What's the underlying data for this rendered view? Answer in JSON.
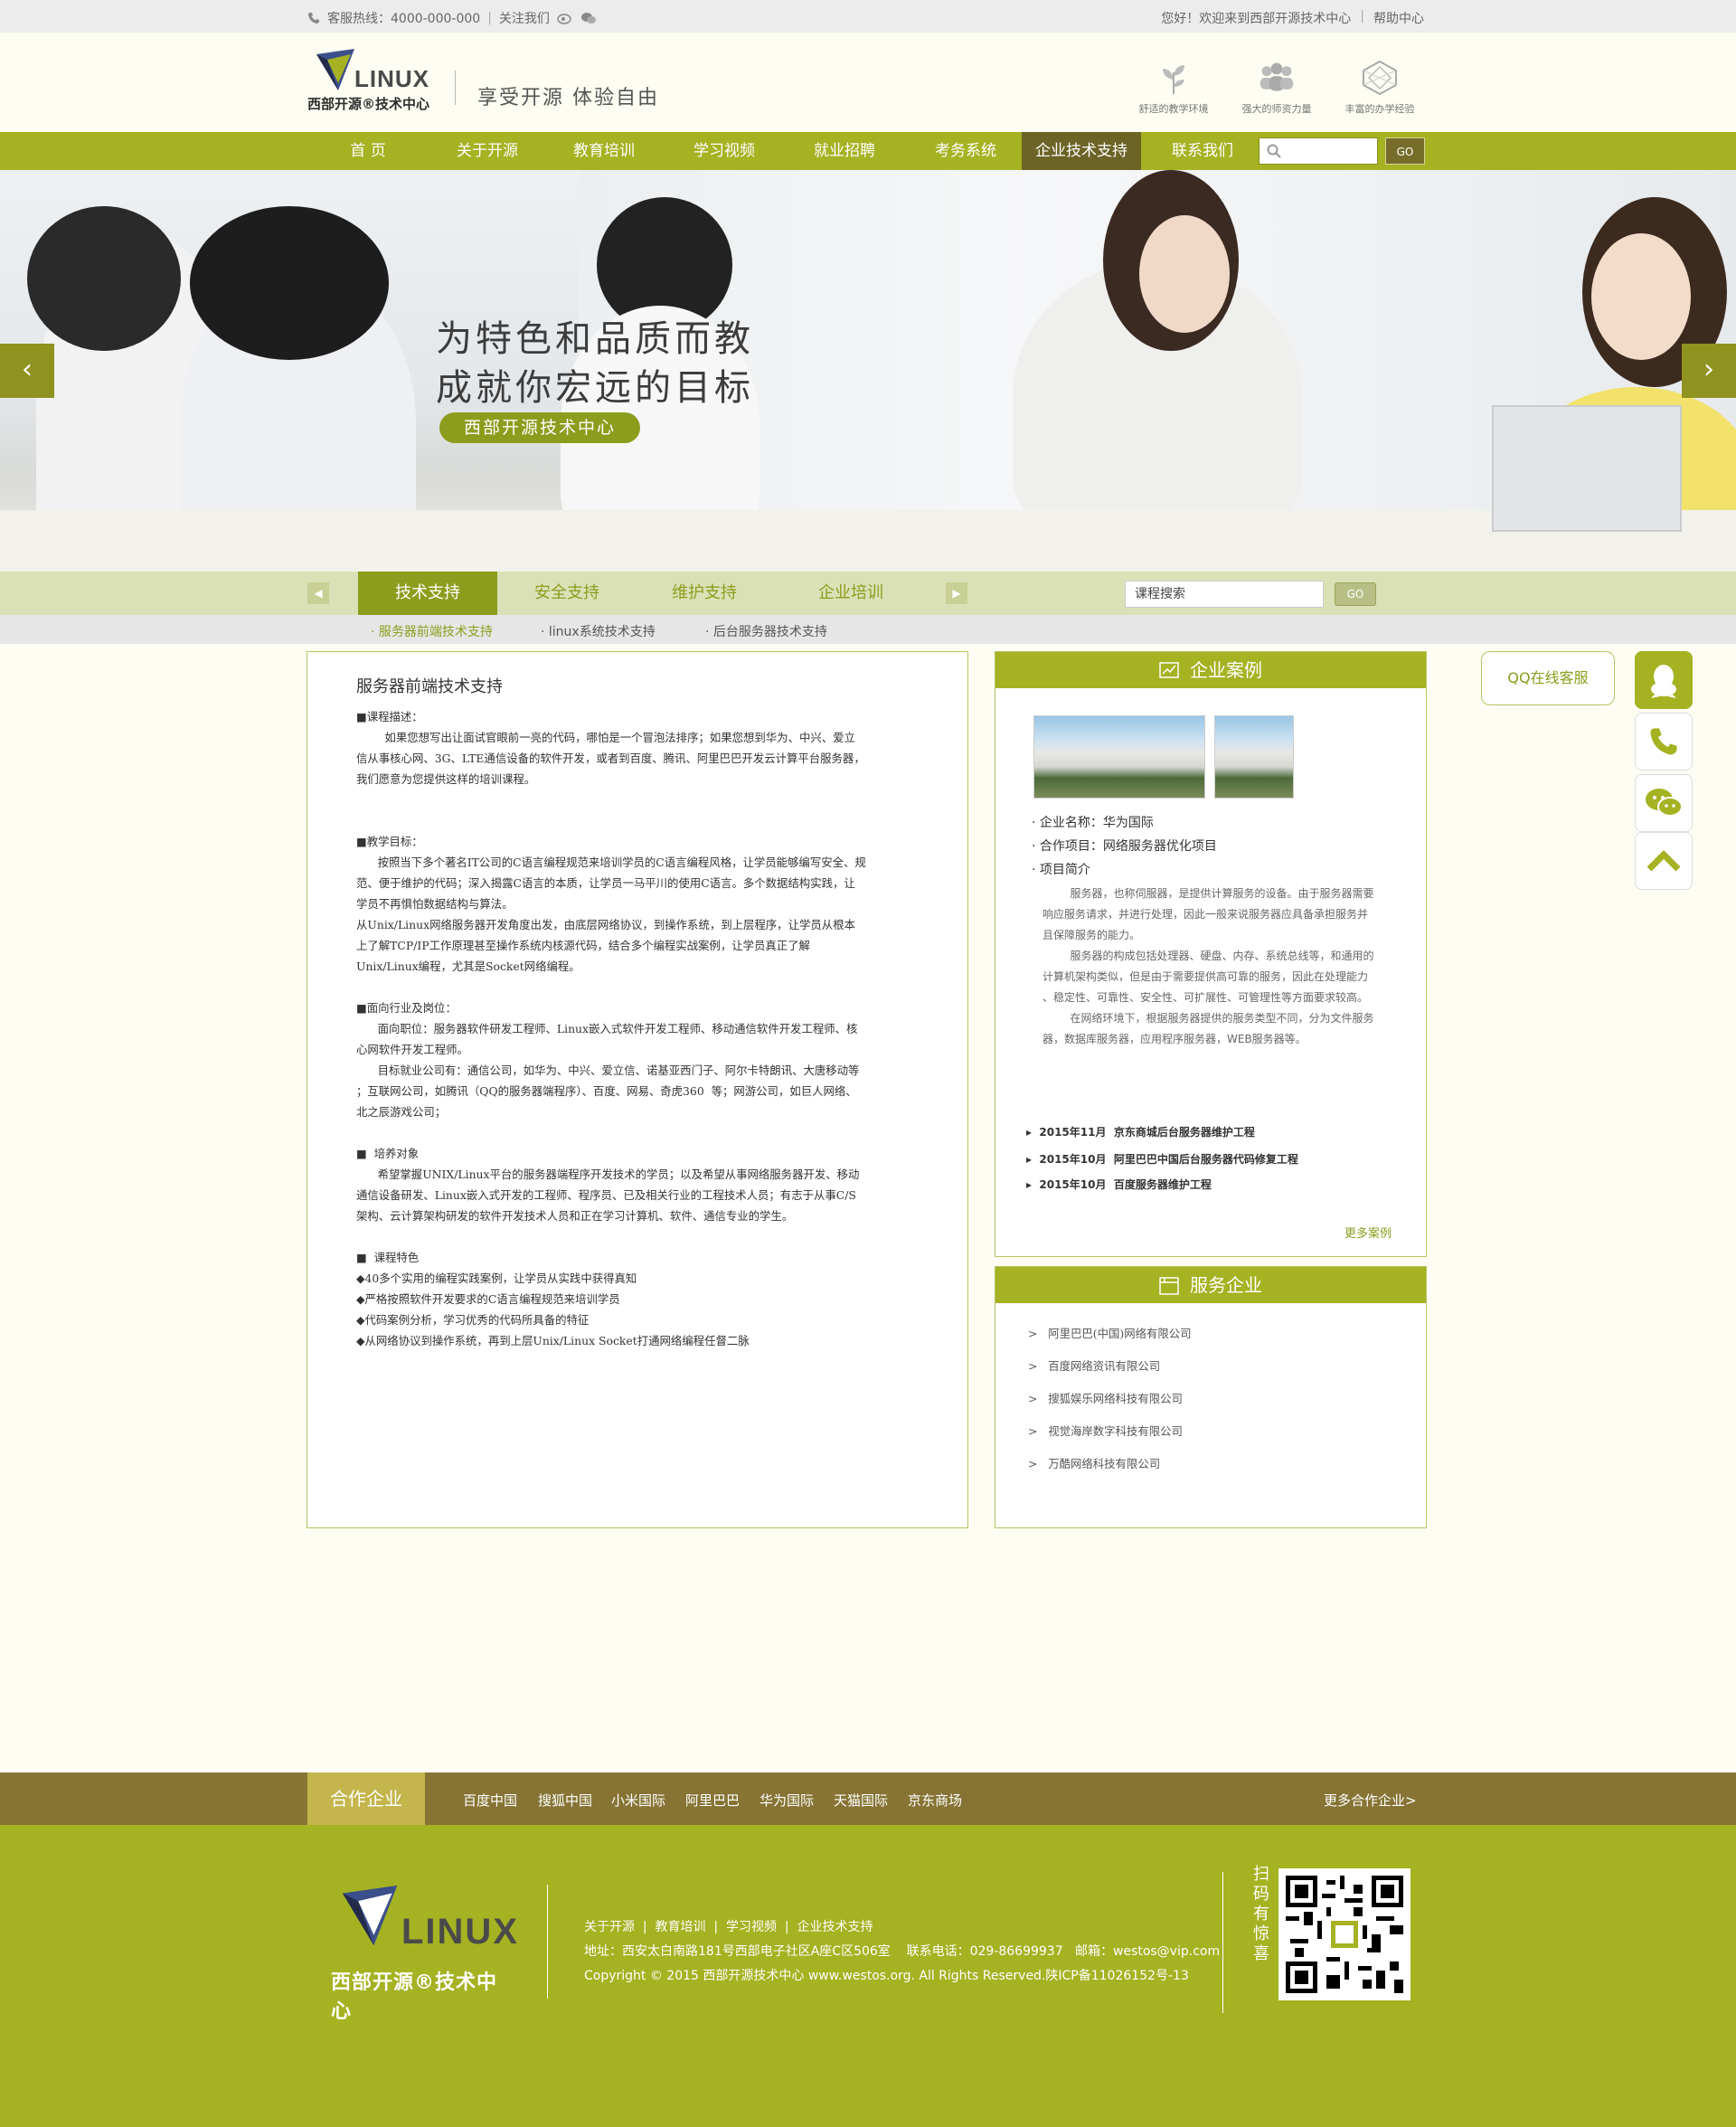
{
  "topbar": {
    "hotline": "客服热线：4000-000-000",
    "follow": "关注我们",
    "welcome": "您好！欢迎来到西部开源技术中心",
    "help": "帮助中心"
  },
  "header": {
    "logo_en": "LINUX",
    "logo_cn": "西部开源®技术中心",
    "slogan": "享受开源  体验自由",
    "features": [
      "舒适的教学环境",
      "强大的师资力量",
      "丰富的办学经验"
    ]
  },
  "nav": {
    "items": [
      "首  页",
      "关于开源",
      "教育培训",
      "学习视频",
      "就业招聘",
      "考务系统",
      "企业技术支持",
      "联系我们"
    ],
    "active": "企业技术支持",
    "search_go": "GO"
  },
  "banner": {
    "line1": "为特色和品质而教",
    "line2": "成就你宏远的目标",
    "tag": "西部开源技术中心",
    "prev": "‹",
    "next": "›"
  },
  "tabs": {
    "items": [
      "技术支持",
      "安全支持",
      "维护支持",
      "企业培训"
    ],
    "search_placeholder": "课程搜索",
    "go": "GO",
    "sub": [
      "· 服务器前端技术支持",
      "· linux系统技术支持",
      "· 后台服务器技术支持"
    ]
  },
  "main": {
    "title": "服务器前端技术支持",
    "paragraphs": [
      "■课程描述：",
      "        如果您想写出让面试官眼前一亮的代码，哪怕是一个冒泡法排序；如果您想到华为、中兴、爱立",
      "信从事核心网、3G、LTE通信设备的软件开发，或者到百度、腾讯、阿里巴巴开发云计算平台服务器，",
      "我们愿意为您提供这样的培训课程。",
      "",
      "",
      "■教学目标：",
      "      按照当下多个著名IT公司的C语言编程规范来培训学员的C语言编程风格，让学员能够编写安全、规",
      "范、便于维护的代码；深入揭露C语言的本质，让学员一马平川的使用C语言。多个数据结构实践，让",
      "学员不再惧怕数据结构与算法。",
      "从Unix/Linux网络服务器开发角度出发，由底层网络协议，到操作系统，到上层程序，让学员从根本",
      "上了解TCP/IP工作原理甚至操作系统内核源代码，结合多个编程实战案例，让学员真正了解",
      "Unix/Linux编程，尤其是Socket网络编程。",
      "",
      "■面向行业及岗位：",
      "      面向职位：服务器软件研发工程师、Linux嵌入式软件开发工程师、移动通信软件开发工程师、核",
      "心网软件开发工程师。",
      "      目标就业公司有：通信公司，如华为、中兴、爱立信、诺基亚西门子、阿尔卡特朗讯、大唐移动等",
      "；互联网公司，如腾讯（QQ的服务器端程序）、百度、网易、奇虎360  等；网游公司，如巨人网络、",
      "北之辰游戏公司；",
      "",
      "■  培养对象",
      "      希望掌握UNIX/Linux平台的服务器端程序开发技术的学员；以及希望从事网络服务器开发、移动",
      "通信设备研发、Linux嵌入式开发的工程师、程序员、已及相关行业的工程技术人员；有志于从事C/S",
      "架构、云计算架构研发的软件开发技术人员和正在学习计算机、软件、通信专业的学生。",
      "",
      "■  课程特色",
      "◆40多个实用的编程实践案例，让学员从实践中获得真知",
      "◆严格按照软件开发要求的C语言编程规范来培训学员",
      "◆代码案例分析，学习优秀的代码所具备的特征",
      "◆从网络协议到操作系统，再到上层Unix/Linux Socket打通网络编程任督二脉"
    ]
  },
  "cases": {
    "title": "企业案例",
    "company": "· 企业名称：华为国际",
    "project": "· 合作项目：网络服务器优化项目",
    "intro": "· 项目简介",
    "desc": [
      "        服务器，也称伺服器，是提供计算服务的设备。由于服务器需要",
      "响应服务请求，并进行处理，因此一般来说服务器应具备承担服务并",
      "且保障服务的能力。",
      "        服务器的构成包括处理器、硬盘、内存、系统总线等，和通用的",
      "计算机架构类似，但是由于需要提供高可靠的服务，因此在处理能力",
      "、稳定性、可靠性、安全性、可扩展性、可管理性等方面要求较高。",
      "        在网络环境下，根据服务器提供的服务类型不同，分为文件服务",
      "器，数据库服务器，应用程序服务器，WEB服务器等。"
    ],
    "projects": [
      "▸  2015年11月  京东商城后台服务器维护工程",
      "▸  2015年10月  阿里巴巴中国后台服务器代码修复工程",
      "▸  2015年10月  百度服务器维护工程"
    ],
    "more": "更多案例"
  },
  "services": {
    "title": "服务企业",
    "items": [
      ">   阿里巴巴(中国)网络有限公司",
      ">   百度网络资讯有限公司",
      ">   搜狐娱乐网络科技有限公司",
      ">   视觉海岸数字科技有限公司",
      ">   万酷网络科技有限公司"
    ]
  },
  "float": {
    "qq": "QQ在线客服"
  },
  "partners": {
    "label": "合作企业",
    "items": [
      "百度中国",
      "搜狐中国",
      "小米国际",
      "阿里巴巴",
      "华为国际",
      "天猫国际",
      "京东商场"
    ],
    "more": "更多合作企业>"
  },
  "footer": {
    "logo_en": "LINUX",
    "logo_cn": "西部开源®技术中心",
    "links": "关于开源  |  教育培训  |  学习视频  |  企业技术支持",
    "address": "地址：西安太白南路181号西部电子社区A座C区506室    联系电话：029-86699937   邮箱：westos@vip.com",
    "copyright": "Copyright © 2015 西部开源技术中心 www.westos.org. All Rights Reserved.陕ICP备11026152号-13",
    "scan": "扫码有惊喜"
  },
  "colors": {
    "accent": "#a5b222",
    "dark": "#6c6326",
    "footer": "#a5b222",
    "partners": "#877434"
  }
}
